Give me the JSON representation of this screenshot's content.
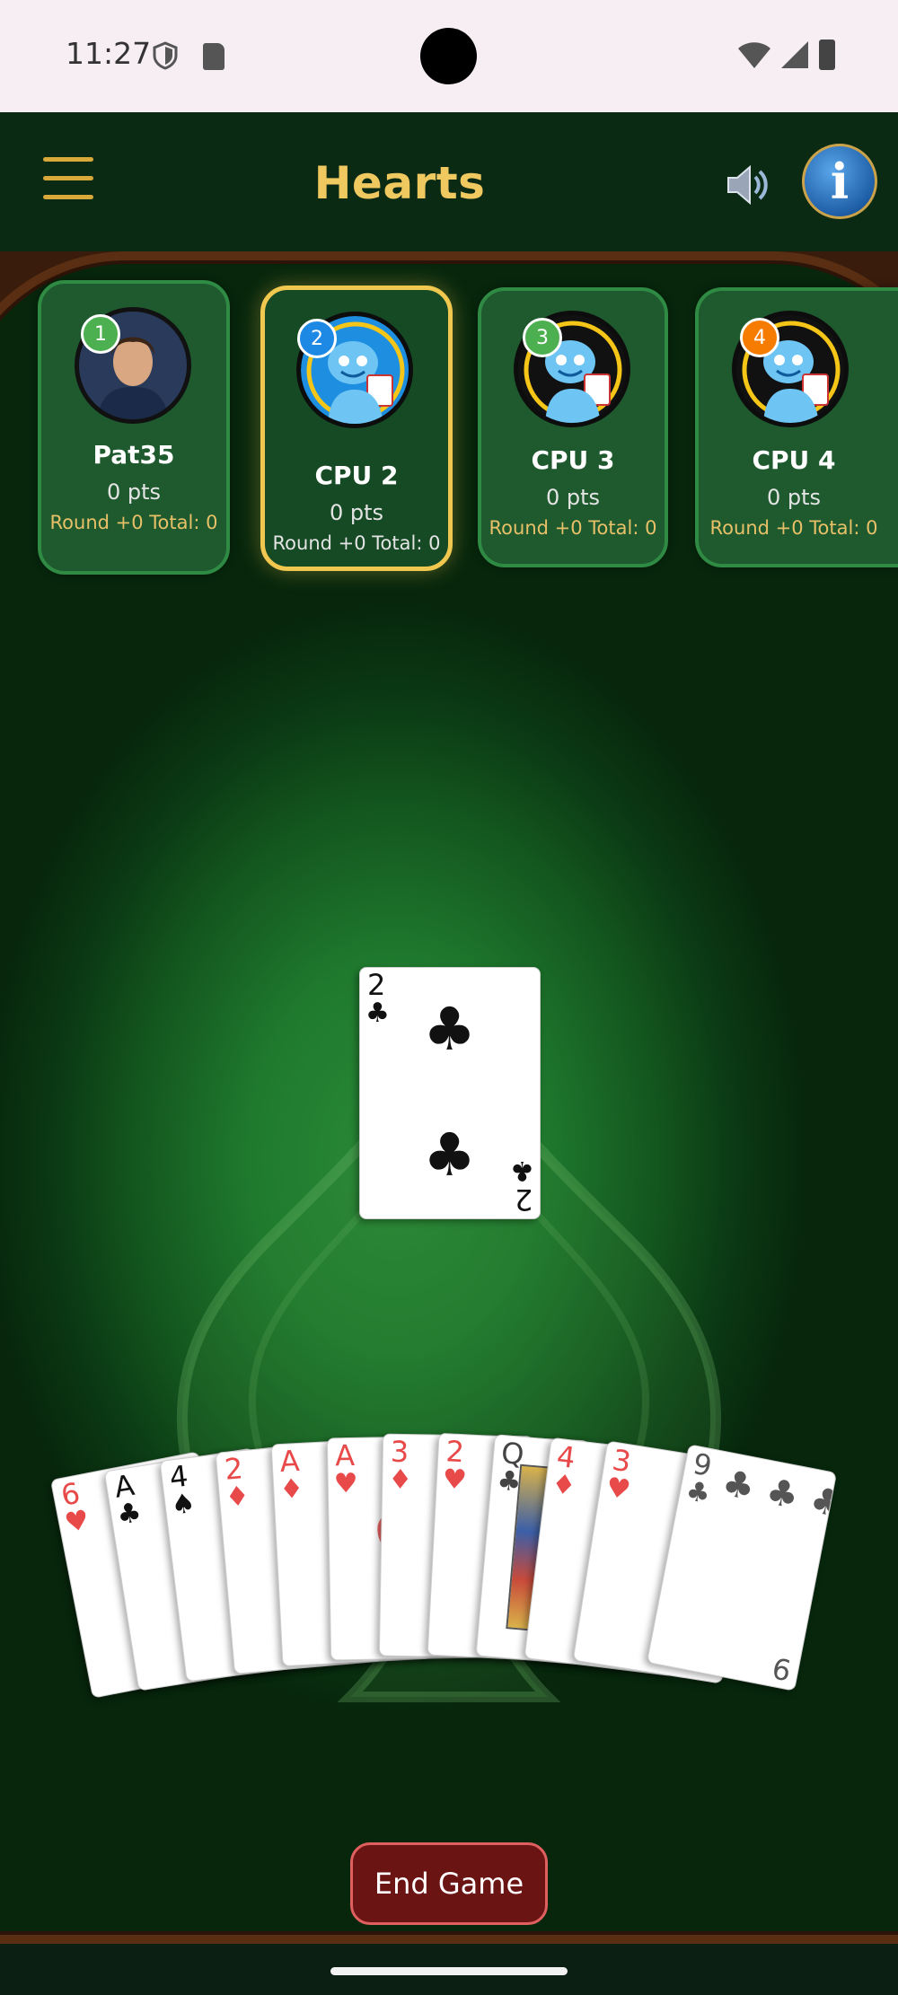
{
  "status_bar": {
    "time": "11:27"
  },
  "header": {
    "title": "Hearts"
  },
  "players": [
    {
      "badge": "1",
      "name": "Pat35",
      "points": "0 pts",
      "round_total": "Round +0  Total: 0",
      "badge_color": "#4caf50"
    },
    {
      "badge": "2",
      "name": "CPU 2",
      "points": "0 pts",
      "round_total": "Round +0  Total: 0",
      "badge_color": "#1e88e5",
      "active": true
    },
    {
      "badge": "3",
      "name": "CPU 3",
      "points": "0 pts",
      "round_total": "Round +0  Total: 0",
      "badge_color": "#4caf50"
    },
    {
      "badge": "4",
      "name": "CPU 4",
      "points": "0 pts",
      "round_total": "Round +0  Total: 0",
      "badge_color": "#f57c00"
    }
  ],
  "center_card": {
    "rank": "2",
    "suit": "♣"
  },
  "hand": [
    {
      "rank": "6",
      "suit": "♥",
      "color": "red"
    },
    {
      "rank": "A",
      "suit": "♣",
      "color": "black"
    },
    {
      "rank": "4",
      "suit": "♠",
      "color": "black"
    },
    {
      "rank": "2",
      "suit": "♦",
      "color": "red"
    },
    {
      "rank": "A",
      "suit": "♦",
      "color": "red"
    },
    {
      "rank": "A",
      "suit": "♥",
      "color": "red"
    },
    {
      "rank": "3",
      "suit": "♦",
      "color": "red"
    },
    {
      "rank": "2",
      "suit": "♥",
      "color": "red"
    },
    {
      "rank": "Q",
      "suit": "♣",
      "color": "black"
    },
    {
      "rank": "4",
      "suit": "♦",
      "color": "red"
    },
    {
      "rank": "3",
      "suit": "♥",
      "color": "red"
    },
    {
      "rank": "9",
      "suit": "♣",
      "color": "black"
    }
  ],
  "buttons": {
    "end_game": "End Game"
  },
  "colors": {
    "felt": "#1f7a2e",
    "gold": "#f0c860",
    "end_button": "#6b1414"
  },
  "icons": [
    "menu-icon",
    "speaker-icon",
    "info-icon"
  ]
}
